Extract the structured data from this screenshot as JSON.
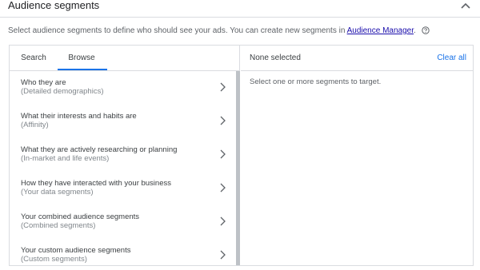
{
  "header": {
    "title": "Audience segments"
  },
  "description": {
    "text": "Select audience segments to define who should see your ads. You can create new segments in ",
    "link": "Audience Manager",
    "suffix": "."
  },
  "tabs": [
    {
      "label": "Search",
      "active": false
    },
    {
      "label": "Browse",
      "active": true
    }
  ],
  "browse_items": [
    {
      "title": "Who they are",
      "subtitle": "(Detailed demographics)"
    },
    {
      "title": "What their interests and habits are",
      "subtitle": "(Affinity)"
    },
    {
      "title": "What they are actively researching or planning",
      "subtitle": "(In-market and life events)"
    },
    {
      "title": "How they have interacted with your business",
      "subtitle": "(Your data segments)"
    },
    {
      "title": "Your combined audience segments",
      "subtitle": "(Combined segments)"
    },
    {
      "title": "Your custom audience segments",
      "subtitle": "(Custom segments)"
    }
  ],
  "selection": {
    "status": "None selected",
    "clear_label": "Clear all",
    "hint": "Select one or more segments to target."
  },
  "colors": {
    "accent": "#1a73e8",
    "link": "#1a0dab",
    "border": "#dadce0"
  },
  "icons": [
    "chevron-up-icon",
    "help-icon",
    "chevron-right-icon"
  ]
}
